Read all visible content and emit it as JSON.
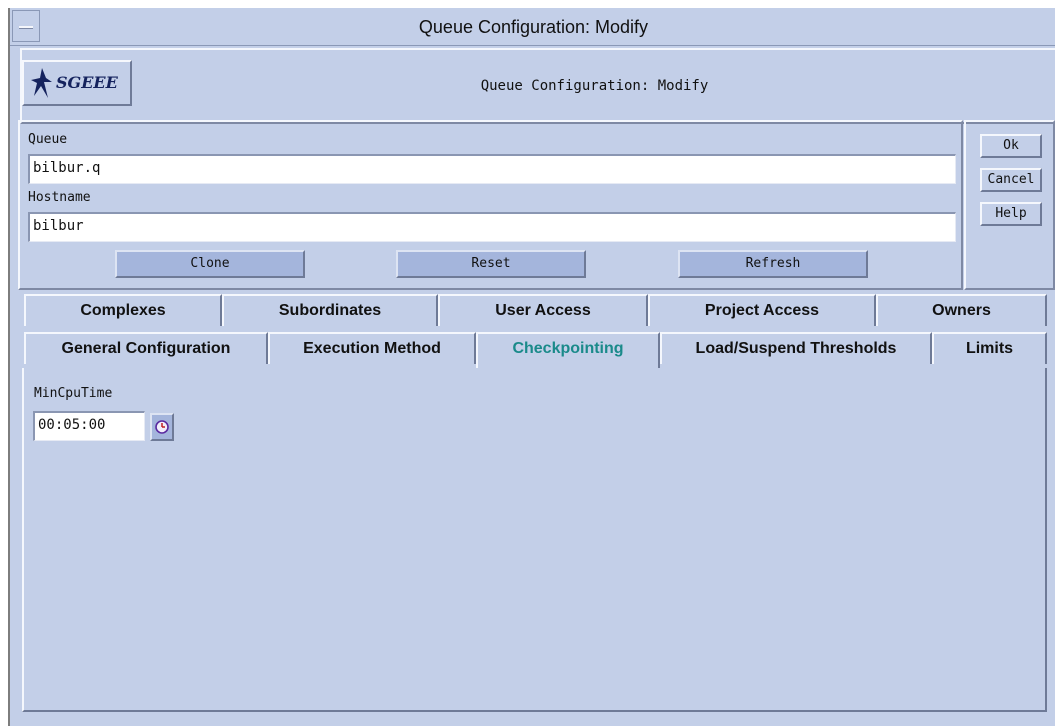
{
  "window": {
    "title": "Queue Configuration: Modify"
  },
  "header": {
    "logo_text": "SGEEE",
    "title": "Queue Configuration: Modify"
  },
  "form": {
    "queue_label": "Queue",
    "queue_value": "bilbur.q",
    "hostname_label": "Hostname",
    "hostname_value": "bilbur"
  },
  "actions": {
    "clone": "Clone",
    "reset": "Reset",
    "refresh": "Refresh"
  },
  "side_buttons": {
    "ok": "Ok",
    "cancel": "Cancel",
    "help": "Help"
  },
  "tabs_back": [
    {
      "label": "Complexes"
    },
    {
      "label": "Subordinates"
    },
    {
      "label": "User Access"
    },
    {
      "label": "Project Access"
    },
    {
      "label": "Owners"
    }
  ],
  "tabs_front": [
    {
      "label": "General Configuration"
    },
    {
      "label": "Execution Method"
    },
    {
      "label": "Checkpointing",
      "active": true
    },
    {
      "label": "Load/Suspend Thresholds"
    },
    {
      "label": "Limits"
    }
  ],
  "checkpointing": {
    "min_cpu_time_label": "MinCpuTime",
    "min_cpu_time_value": "00:05:00",
    "clock_icon": "clock-icon"
  },
  "colors": {
    "background": "#c3cfe8",
    "active_tab_text": "#1a8a8a",
    "button_fill": "#a4b5dc"
  }
}
